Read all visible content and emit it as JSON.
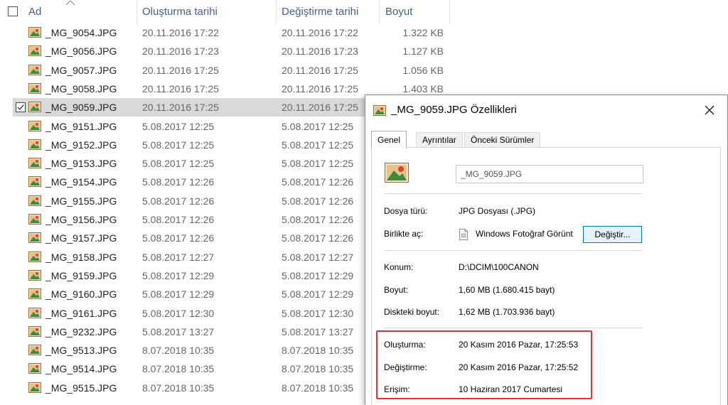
{
  "header": {
    "col_name": "Ad",
    "col_created": "Oluşturma tarihi",
    "col_modified": "Değiştirme tarihi",
    "col_size": "Boyut"
  },
  "files": [
    {
      "name": "_MG_9054.JPG",
      "created": "20.11.2016 17:22",
      "modified": "20.11.2016 17:22",
      "size": "1.322 KB"
    },
    {
      "name": "_MG_9056.JPG",
      "created": "20.11.2016 17:23",
      "modified": "20.11.2016 17:23",
      "size": "1.127 KB"
    },
    {
      "name": "_MG_9057.JPG",
      "created": "20.11.2016 17:25",
      "modified": "20.11.2016 17:25",
      "size": "1.056 KB"
    },
    {
      "name": "_MG_9058.JPG",
      "created": "20.11.2016 17:25",
      "modified": "20.11.2016 17:25",
      "size": "1.403 KB"
    },
    {
      "name": "_MG_9059.JPG",
      "created": "20.11.2016 17:25",
      "modified": "20.11.2016 17:25",
      "size": "",
      "selected": true
    },
    {
      "name": "_MG_9151.JPG",
      "created": "5.08.2017 12:25",
      "modified": "5.08.2017 12:25",
      "size": ""
    },
    {
      "name": "_MG_9152.JPG",
      "created": "5.08.2017 12:25",
      "modified": "5.08.2017 12:25",
      "size": ""
    },
    {
      "name": "_MG_9153.JPG",
      "created": "5.08.2017 12:25",
      "modified": "5.08.2017 12:25",
      "size": ""
    },
    {
      "name": "_MG_9154.JPG",
      "created": "5.08.2017 12:26",
      "modified": "5.08.2017 12:26",
      "size": ""
    },
    {
      "name": "_MG_9155.JPG",
      "created": "5.08.2017 12:26",
      "modified": "5.08.2017 12:26",
      "size": ""
    },
    {
      "name": "_MG_9156.JPG",
      "created": "5.08.2017 12:26",
      "modified": "5.08.2017 12:26",
      "size": ""
    },
    {
      "name": "_MG_9157.JPG",
      "created": "5.08.2017 12:26",
      "modified": "5.08.2017 12:26",
      "size": ""
    },
    {
      "name": "_MG_9158.JPG",
      "created": "5.08.2017 12:27",
      "modified": "5.08.2017 12:27",
      "size": ""
    },
    {
      "name": "_MG_9159.JPG",
      "created": "5.08.2017 12:29",
      "modified": "5.08.2017 12:29",
      "size": ""
    },
    {
      "name": "_MG_9160.JPG",
      "created": "5.08.2017 12:29",
      "modified": "5.08.2017 12:29",
      "size": ""
    },
    {
      "name": "_MG_9161.JPG",
      "created": "5.08.2017 12:30",
      "modified": "5.08.2017 12:30",
      "size": ""
    },
    {
      "name": "_MG_9232.JPG",
      "created": "5.08.2017 13:27",
      "modified": "5.08.2017 13:27",
      "size": ""
    },
    {
      "name": "_MG_9513.JPG",
      "created": "8.07.2018 10:35",
      "modified": "8.07.2018 10:35",
      "size": ""
    },
    {
      "name": "_MG_9514.JPG",
      "created": "8.07.2018 10:35",
      "modified": "8.07.2018 10:35",
      "size": ""
    },
    {
      "name": "_MG_9515.JPG",
      "created": "8.07.2018 10:35",
      "modified": "8.07.2018 10:35",
      "size": ""
    }
  ],
  "dialog": {
    "title": "_MG_9059.JPG Özellikleri",
    "tabs": [
      "Genel",
      "Ayrıntılar",
      "Önceki Sürümler"
    ],
    "filename": "_MG_9059.JPG",
    "type_label": "Dosya türü:",
    "type_value": "JPG Dosyası (.JPG)",
    "openwith_label": "Birlikte aç:",
    "openwith_value": "Windows Fotoğraf Görünt",
    "change_button": "Değiştir...",
    "location_label": "Konum:",
    "location_value": "D:\\DCIM\\100CANON",
    "size_label": "Boyut:",
    "size_value": "1,60 MB (1.680.415 bayt)",
    "disksize_label": "Diskteki boyut:",
    "disksize_value": "1,62 MB (1.703.936 bayt)",
    "created_label": "Oluşturma:",
    "created_value": "20 Kasım 2016 Pazar, 17:25:53",
    "modified_label": "Değiştirme:",
    "modified_value": "20 Kasım 2016 Pazar, 17:25:52",
    "accessed_label": "Erişim:",
    "accessed_value": "10 Haziran 2017 Cumartesi"
  },
  "colors": {
    "highlight_box": "#e03131",
    "selected_row": "#d9d9d9",
    "header_text": "#4a5f83",
    "button_border": "#0078d7"
  }
}
